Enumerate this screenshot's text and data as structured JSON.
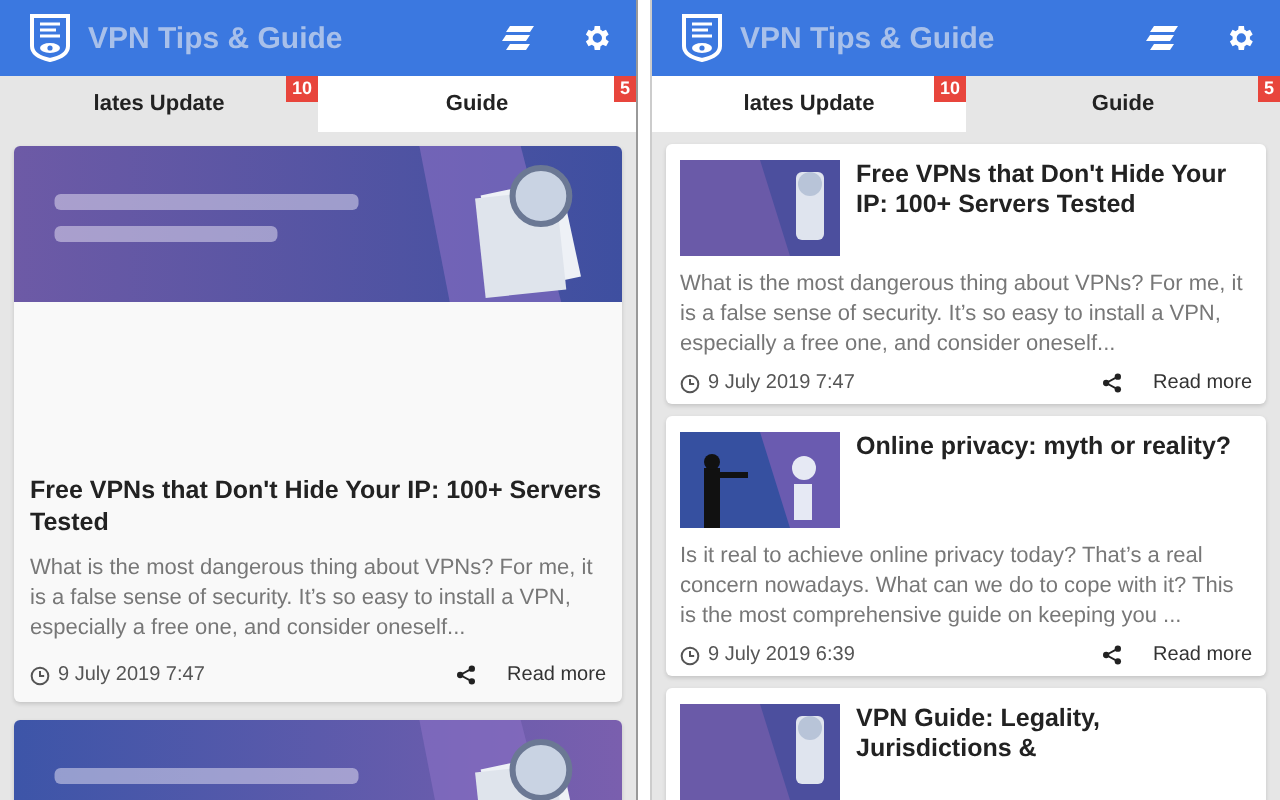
{
  "panels": [
    {
      "header": {
        "title": "VPN Tips & Guide"
      },
      "tabs": [
        {
          "label": "lates Update",
          "badge": "10",
          "selected": false
        },
        {
          "label": "Guide",
          "badge": "5",
          "selected": true
        }
      ],
      "articles": [
        {
          "kind": "banner",
          "title": "Free VPNs that Don't Hide Your IP: 100+ Servers Tested",
          "excerpt": "What is the most dangerous thing about VPNs? For me, it is a false sense of security. It’s so easy to install a VPN, especially a free one, and consider oneself...",
          "date": "9 July 2019 7:47",
          "action": "Read more"
        },
        {
          "kind": "banner"
        }
      ]
    },
    {
      "header": {
        "title": "VPN Tips & Guide"
      },
      "tabs": [
        {
          "label": "lates Update",
          "badge": "10",
          "selected": true
        },
        {
          "label": "Guide",
          "badge": "5",
          "selected": false
        }
      ],
      "articles": [
        {
          "kind": "thumb",
          "title": "Free VPNs that Don't Hide Your IP: 100+ Servers Tested",
          "excerpt": "What is the most dangerous thing about VPNs? For me, it is a false sense of security. It’s so easy to install a VPN, especially a free one, and consider oneself...",
          "date": "9 July 2019 7:47",
          "action": "Read more"
        },
        {
          "kind": "thumb",
          "title": "Online privacy: myth or reality?",
          "excerpt": "Is it real to achieve online privacy today? That’s a real concern nowadays. What can we do to cope with it? This is the most comprehensive guide on keeping you ...",
          "date": "9 July 2019 6:39",
          "action": "Read more"
        },
        {
          "kind": "thumb",
          "title": "VPN Guide: Legality, Jurisdictions &"
        }
      ]
    }
  ]
}
